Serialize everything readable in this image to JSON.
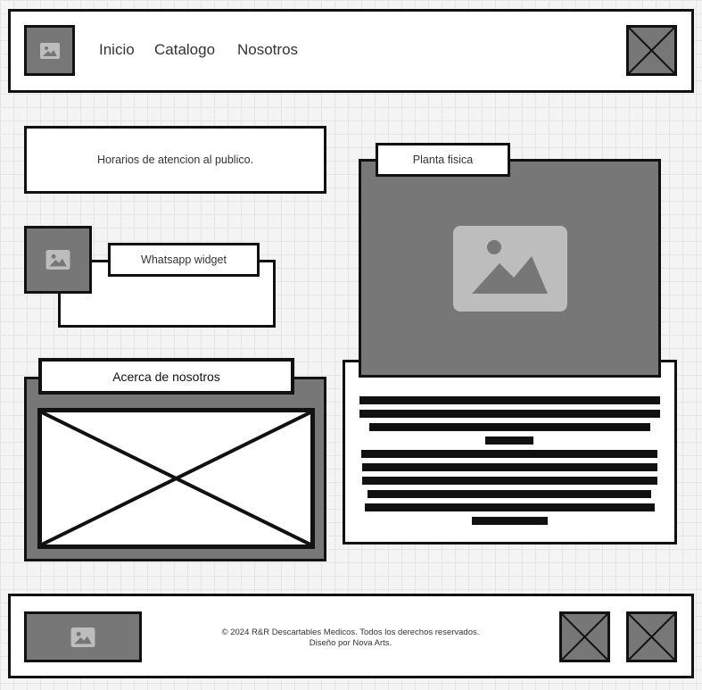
{
  "header": {
    "logo_icon": "image-icon",
    "nav": [
      {
        "label": "Inicio"
      },
      {
        "label": "Catalogo"
      },
      {
        "label": "Nosotros"
      }
    ],
    "menu_icon": "x-placeholder-icon"
  },
  "hours": {
    "text": "Horarios de atencion al publico."
  },
  "whatsapp": {
    "label": "Whatsapp widget",
    "icon": "image-icon"
  },
  "about": {
    "title": "Acerca de nosotros"
  },
  "plant": {
    "title": "Planta fisica",
    "image_icon": "image-icon"
  },
  "footer": {
    "copyright": "© 2024 R&R Descartables Medicos. Todos los derechos reservados.",
    "design": "Diseño por Nova Arts.",
    "logo_icon": "image-icon"
  },
  "colors": {
    "placeholder_grey": "#777777",
    "border": "#111111",
    "background": "#f4f4f4"
  }
}
